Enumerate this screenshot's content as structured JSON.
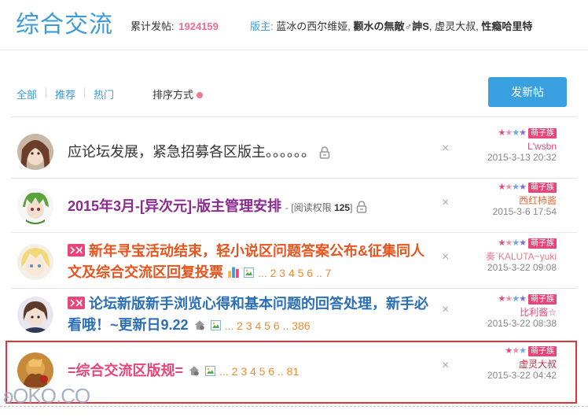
{
  "header": {
    "forum_title": "综合交流",
    "post_count_label": "累计发帖:",
    "post_count": "1924159",
    "moderators_label": "版主:",
    "moderators": [
      {
        "name": "蓝冰の西尔维娅",
        "bold": false
      },
      {
        "name": "颧水の無敵♂訷S",
        "bold": true
      },
      {
        "name": "虚灵大叔",
        "bold": false
      },
      {
        "name": "性瘾哈里特",
        "bold": true
      }
    ]
  },
  "toolbar": {
    "tabs": [
      "全部",
      "推荐",
      "热门"
    ],
    "sort_label": "排序方式",
    "new_post_label": "发新帖"
  },
  "threads": [
    {
      "title": "应论坛发展，紧急招募各区版主。。。。。。",
      "title_color": "#333333",
      "author": "L'wsbn",
      "author_color": "#e8467a",
      "date": "2015-3-13 20:32",
      "badge": "萌子族",
      "locked": true
    },
    {
      "title": "2015年3月-[异次元]-版主管理安排",
      "title_color": "#8b2b8f",
      "perm_label": "[阅读权限",
      "perm_value": "125",
      "perm_close": "]",
      "author": "西红柿酱",
      "author_color": "#e26f3c",
      "date": "2015-3-6 17:54",
      "badge": "萌子族",
      "locked": true
    },
    {
      "title_line1": "新年寻宝活动结束，轻小说区问题答案公布&征集同人",
      "title_line2": "文及综合交流区回复投票",
      "title_color": "#e8541e",
      "pages": "... 2 3 4 5 6 .. 7",
      "author": "奏`KALUTA~yuki",
      "author_color": "#f07b8e",
      "date": "2015-3-22 09:08",
      "badge": "萌子族"
    },
    {
      "title_line1": "论坛新版新手浏览心得和基本问题的回答处理，新手必",
      "title_line2": "看哦！~更新日9.22",
      "title_color": "#2a6fb8",
      "pages": "... 2 3 4 5 6 .. 386",
      "author": "比利酱☆",
      "author_color": "#e8467a",
      "date": "2015-3-22 08:38",
      "badge": "萌子族"
    },
    {
      "title": "=综合交流区版规=",
      "title_color": "#e8467a",
      "pages": "... 2 3 4 5 6 .. 81",
      "author": "虚灵大叔",
      "author_color": "#d8283e",
      "date": "2015-3-22 04:42",
      "badge": "萌子族"
    }
  ],
  "close_glyph": "×",
  "watermark": "ʚOKO.CO",
  "colors": {
    "accent": "#3a9bd8",
    "highlight_border": "#e0343b",
    "page_link": "#f08c2e"
  }
}
